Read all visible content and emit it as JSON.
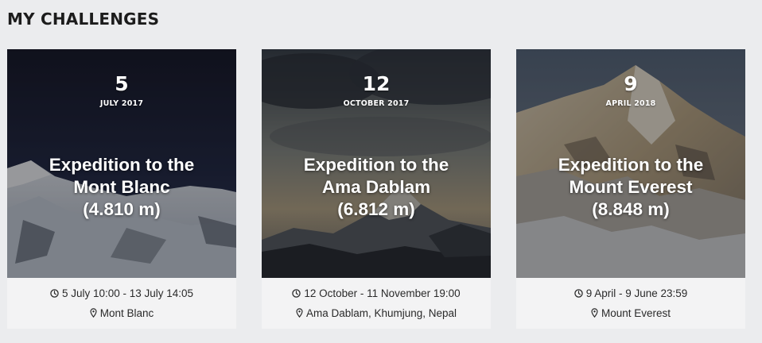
{
  "page": {
    "title": "MY CHALLENGES"
  },
  "challenges": [
    {
      "day": "5",
      "month_year": "JULY 2017",
      "title_lines": [
        "Expedition to the",
        "Mont Blanc",
        "(4.810 m)"
      ],
      "time_range": "5 July 10:00 - 13 July 14:05",
      "location": "Mont Blanc",
      "time_icon": "clock-icon",
      "location_icon": "map-pin-icon"
    },
    {
      "day": "12",
      "month_year": "OCTOBER 2017",
      "title_lines": [
        "Expedition to the",
        "Ama Dablam",
        "(6.812 m)"
      ],
      "time_range": "12 October - 11 November 19:00",
      "location": "Ama Dablam, Khumjung, Nepal",
      "time_icon": "clock-icon",
      "location_icon": "map-pin-icon"
    },
    {
      "day": "9",
      "month_year": "APRIL 2018",
      "title_lines": [
        "Expedition to the",
        "Mount Everest",
        "(8.848 m)"
      ],
      "time_range": "9 April - 9 June 23:59",
      "location": "Mount Everest",
      "time_icon": "clock-icon",
      "location_icon": "map-pin-icon"
    }
  ],
  "colors": {
    "page_background": "#ebecee",
    "card_footer": "#f3f3f4",
    "overlay_text": "#ffffff"
  }
}
